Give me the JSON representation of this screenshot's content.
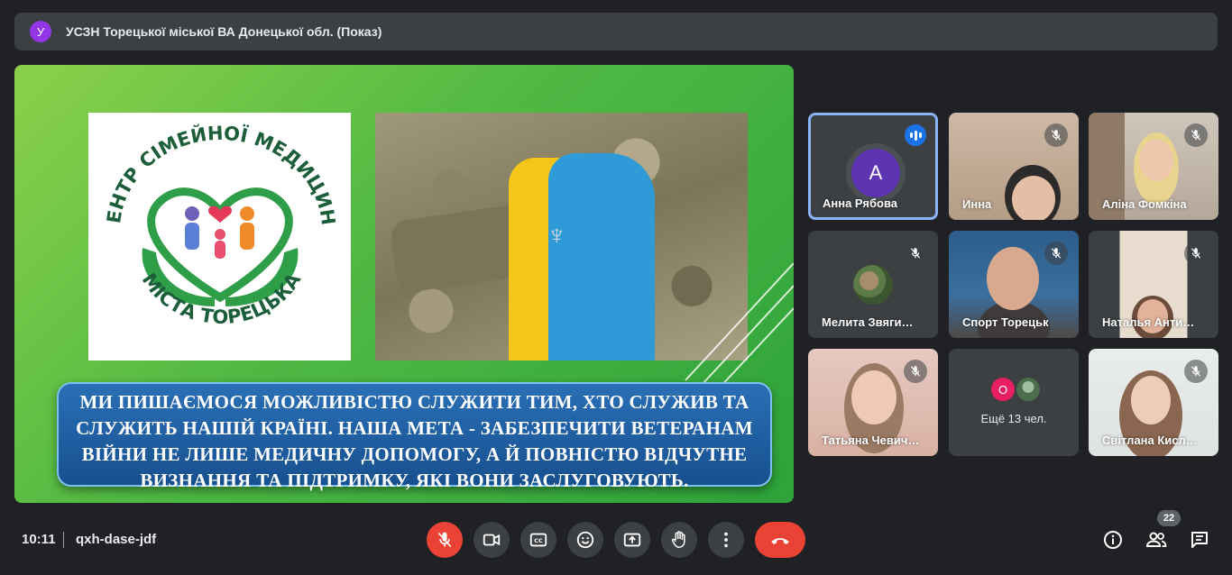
{
  "presenter": {
    "avatar_letter": "У",
    "title": "УСЗН Торецької міської ВА Донецької обл. (Показ)"
  },
  "slide": {
    "logo_text_top": "ЦЕНТР СІМЕЙНОЇ МЕДИЦИНИ",
    "logo_text_bottom": "МІСТА ТОРЕЦЬКА",
    "caption": "МИ ПИШАЄМОСЯ МОЖЛИВІСТЮ СЛУЖИТИ ТИМ, ХТО СЛУЖИВ ТА СЛУЖИТЬ НАШІЙ КРАЇНІ. НАША МЕТА - ЗАБЕЗПЕЧИТИ ВЕТЕРАНАМ ВІЙНИ НЕ ЛИШЕ МЕДИЧНУ ДОПОМОГУ, А Й ПОВНІСТЮ ВІДЧУТНЕ ВИЗНАННЯ ТА ПІДТРИМКУ, ЯКІ ВОНИ ЗАСЛУГОВУЮТЬ."
  },
  "participants": [
    {
      "name": "Анна Рябова",
      "avatar_letter": "А",
      "speaking": true
    },
    {
      "name": "Инна",
      "muted": true
    },
    {
      "name": "Аліна Фомкіна",
      "muted": true
    },
    {
      "name": "Мелита Звяги…",
      "muted": true
    },
    {
      "name": "Спорт Торецьк",
      "muted": true
    },
    {
      "name": "Наталья Анти…",
      "muted": true
    },
    {
      "name": "Татьяна Чевич…",
      "muted": true
    },
    {
      "name": "Світлана Кисл…",
      "muted": true
    }
  ],
  "more": {
    "avatar_letter": "О",
    "label": "Ещё 13 чел."
  },
  "bottom": {
    "time": "10:11",
    "meeting_code": "qxh-dase-jdf",
    "people_count": "22"
  },
  "colors": {
    "accent": "#8ab4f8",
    "end_call": "#ea4335",
    "surface": "#3c4043",
    "background": "#202124"
  }
}
